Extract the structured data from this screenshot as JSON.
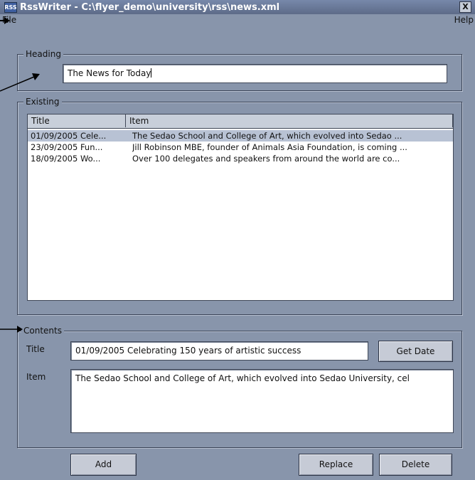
{
  "window": {
    "title": "RssWriter - C:\\flyer_demo\\university\\rss\\news.xml",
    "icon_text": "RSS",
    "close_symbol": "X"
  },
  "menu": {
    "file": "File",
    "help": "Help"
  },
  "heading": {
    "group_label": "Heading",
    "value": "The News for Today"
  },
  "existing": {
    "group_label": "Existing",
    "columns": [
      "Title",
      "Item"
    ],
    "rows": [
      {
        "title": "01/09/2005 Cele...",
        "item": "The Sedao School and College of Art, which evolved into Sedao ...",
        "selected": true
      },
      {
        "title": "23/09/2005 Fun...",
        "item": "Jill Robinson MBE, founder of Animals Asia Foundation, is coming ...",
        "selected": false
      },
      {
        "title": "18/09/2005 Wo...",
        "item": "Over 100 delegates and speakers from around the world are co...",
        "selected": false
      }
    ]
  },
  "contents": {
    "group_label": "Contents",
    "title_label": "Title",
    "title_value": "01/09/2005 Celebrating 150 years of artistic success",
    "get_date_label": "Get Date",
    "item_label": "Item",
    "item_value": "The Sedao School and College of Art, which evolved into Sedao University, cel"
  },
  "buttons": {
    "add": "Add",
    "replace": "Replace",
    "delete": "Delete"
  }
}
